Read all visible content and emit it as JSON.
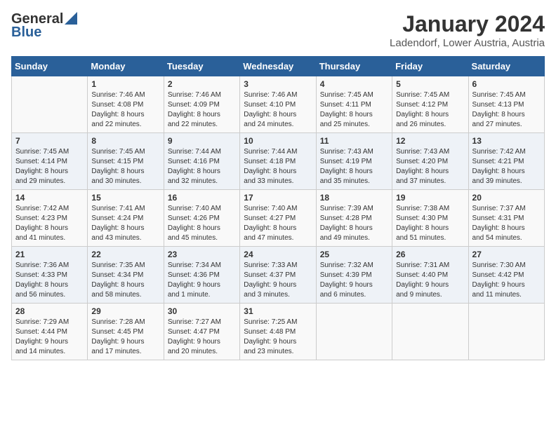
{
  "logo": {
    "general": "General",
    "blue": "Blue"
  },
  "title": {
    "month_year": "January 2024",
    "location": "Ladendorf, Lower Austria, Austria"
  },
  "days_of_week": [
    "Sunday",
    "Monday",
    "Tuesday",
    "Wednesday",
    "Thursday",
    "Friday",
    "Saturday"
  ],
  "weeks": [
    [
      {
        "day": "",
        "info": ""
      },
      {
        "day": "1",
        "info": "Sunrise: 7:46 AM\nSunset: 4:08 PM\nDaylight: 8 hours\nand 22 minutes."
      },
      {
        "day": "2",
        "info": "Sunrise: 7:46 AM\nSunset: 4:09 PM\nDaylight: 8 hours\nand 22 minutes."
      },
      {
        "day": "3",
        "info": "Sunrise: 7:46 AM\nSunset: 4:10 PM\nDaylight: 8 hours\nand 24 minutes."
      },
      {
        "day": "4",
        "info": "Sunrise: 7:45 AM\nSunset: 4:11 PM\nDaylight: 8 hours\nand 25 minutes."
      },
      {
        "day": "5",
        "info": "Sunrise: 7:45 AM\nSunset: 4:12 PM\nDaylight: 8 hours\nand 26 minutes."
      },
      {
        "day": "6",
        "info": "Sunrise: 7:45 AM\nSunset: 4:13 PM\nDaylight: 8 hours\nand 27 minutes."
      }
    ],
    [
      {
        "day": "7",
        "info": "Sunrise: 7:45 AM\nSunset: 4:14 PM\nDaylight: 8 hours\nand 29 minutes."
      },
      {
        "day": "8",
        "info": "Sunrise: 7:45 AM\nSunset: 4:15 PM\nDaylight: 8 hours\nand 30 minutes."
      },
      {
        "day": "9",
        "info": "Sunrise: 7:44 AM\nSunset: 4:16 PM\nDaylight: 8 hours\nand 32 minutes."
      },
      {
        "day": "10",
        "info": "Sunrise: 7:44 AM\nSunset: 4:18 PM\nDaylight: 8 hours\nand 33 minutes."
      },
      {
        "day": "11",
        "info": "Sunrise: 7:43 AM\nSunset: 4:19 PM\nDaylight: 8 hours\nand 35 minutes."
      },
      {
        "day": "12",
        "info": "Sunrise: 7:43 AM\nSunset: 4:20 PM\nDaylight: 8 hours\nand 37 minutes."
      },
      {
        "day": "13",
        "info": "Sunrise: 7:42 AM\nSunset: 4:21 PM\nDaylight: 8 hours\nand 39 minutes."
      }
    ],
    [
      {
        "day": "14",
        "info": "Sunrise: 7:42 AM\nSunset: 4:23 PM\nDaylight: 8 hours\nand 41 minutes."
      },
      {
        "day": "15",
        "info": "Sunrise: 7:41 AM\nSunset: 4:24 PM\nDaylight: 8 hours\nand 43 minutes."
      },
      {
        "day": "16",
        "info": "Sunrise: 7:40 AM\nSunset: 4:26 PM\nDaylight: 8 hours\nand 45 minutes."
      },
      {
        "day": "17",
        "info": "Sunrise: 7:40 AM\nSunset: 4:27 PM\nDaylight: 8 hours\nand 47 minutes."
      },
      {
        "day": "18",
        "info": "Sunrise: 7:39 AM\nSunset: 4:28 PM\nDaylight: 8 hours\nand 49 minutes."
      },
      {
        "day": "19",
        "info": "Sunrise: 7:38 AM\nSunset: 4:30 PM\nDaylight: 8 hours\nand 51 minutes."
      },
      {
        "day": "20",
        "info": "Sunrise: 7:37 AM\nSunset: 4:31 PM\nDaylight: 8 hours\nand 54 minutes."
      }
    ],
    [
      {
        "day": "21",
        "info": "Sunrise: 7:36 AM\nSunset: 4:33 PM\nDaylight: 8 hours\nand 56 minutes."
      },
      {
        "day": "22",
        "info": "Sunrise: 7:35 AM\nSunset: 4:34 PM\nDaylight: 8 hours\nand 58 minutes."
      },
      {
        "day": "23",
        "info": "Sunrise: 7:34 AM\nSunset: 4:36 PM\nDaylight: 9 hours\nand 1 minute."
      },
      {
        "day": "24",
        "info": "Sunrise: 7:33 AM\nSunset: 4:37 PM\nDaylight: 9 hours\nand 3 minutes."
      },
      {
        "day": "25",
        "info": "Sunrise: 7:32 AM\nSunset: 4:39 PM\nDaylight: 9 hours\nand 6 minutes."
      },
      {
        "day": "26",
        "info": "Sunrise: 7:31 AM\nSunset: 4:40 PM\nDaylight: 9 hours\nand 9 minutes."
      },
      {
        "day": "27",
        "info": "Sunrise: 7:30 AM\nSunset: 4:42 PM\nDaylight: 9 hours\nand 11 minutes."
      }
    ],
    [
      {
        "day": "28",
        "info": "Sunrise: 7:29 AM\nSunset: 4:44 PM\nDaylight: 9 hours\nand 14 minutes."
      },
      {
        "day": "29",
        "info": "Sunrise: 7:28 AM\nSunset: 4:45 PM\nDaylight: 9 hours\nand 17 minutes."
      },
      {
        "day": "30",
        "info": "Sunrise: 7:27 AM\nSunset: 4:47 PM\nDaylight: 9 hours\nand 20 minutes."
      },
      {
        "day": "31",
        "info": "Sunrise: 7:25 AM\nSunset: 4:48 PM\nDaylight: 9 hours\nand 23 minutes."
      },
      {
        "day": "",
        "info": ""
      },
      {
        "day": "",
        "info": ""
      },
      {
        "day": "",
        "info": ""
      }
    ]
  ]
}
